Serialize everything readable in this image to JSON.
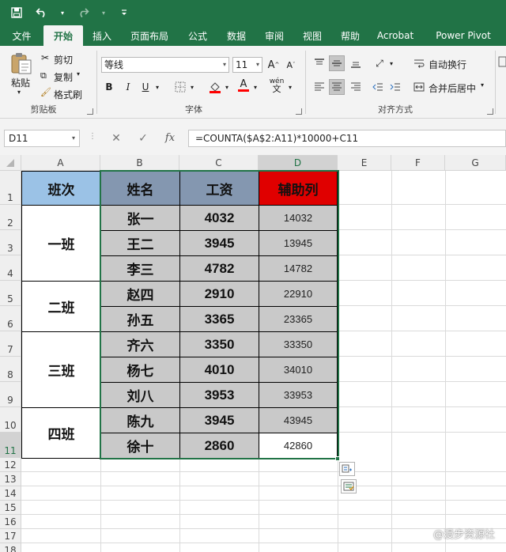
{
  "quick_access": {
    "save": "save-icon",
    "undo": "undo-icon",
    "redo": "redo-icon",
    "customize": "customize-icon"
  },
  "tabs": [
    "文件",
    "开始",
    "插入",
    "页面布局",
    "公式",
    "数据",
    "审阅",
    "视图",
    "帮助",
    "Acrobat",
    "Power Pivot"
  ],
  "active_tab": "开始",
  "ribbon": {
    "clipboard": {
      "paste": "粘贴",
      "cut": "剪切",
      "copy": "复制",
      "format_painter": "格式刷",
      "label": "剪贴板"
    },
    "font": {
      "name": "等线",
      "size": "11",
      "grow": "A",
      "shrink": "A",
      "bold": "B",
      "italic": "I",
      "underline": "U",
      "wen": "wén",
      "label": "字体"
    },
    "alignment": {
      "wrap": "自动换行",
      "merge": "合并后居中",
      "label": "对齐方式"
    }
  },
  "formula_bar": {
    "name_box": "D11",
    "cancel": "✕",
    "confirm": "✓",
    "fx": "fx",
    "formula": "=COUNTA($A$2:A11)*10000+C11"
  },
  "columns": [
    "A",
    "B",
    "C",
    "D",
    "E",
    "F",
    "G"
  ],
  "rows": [
    "1",
    "2",
    "3",
    "4",
    "5",
    "6",
    "7",
    "8",
    "9",
    "10",
    "11",
    "12",
    "13",
    "14",
    "15",
    "16",
    "17",
    "18"
  ],
  "table": {
    "headers": [
      "班次",
      "姓名",
      "工资",
      "辅助列"
    ],
    "classes": [
      "一班",
      "二班",
      "三班",
      "四班"
    ],
    "names": [
      "张一",
      "王二",
      "李三",
      "赵四",
      "孙五",
      "齐六",
      "杨七",
      "刘八",
      "陈九",
      "徐十"
    ],
    "salaries": [
      "4032",
      "3945",
      "4782",
      "2910",
      "3365",
      "3350",
      "4010",
      "3953",
      "3945",
      "2860"
    ],
    "helper": [
      "14032",
      "13945",
      "14782",
      "22910",
      "23365",
      "33350",
      "34010",
      "33953",
      "43945",
      "42860"
    ]
  },
  "colors": {
    "excel_green": "#217346",
    "header_a": "#9bc2e6",
    "header_bc": "#8497b0",
    "header_d": "#e00000",
    "data_fill": "#c9c9c9"
  },
  "watermark": "@漫步资源社"
}
